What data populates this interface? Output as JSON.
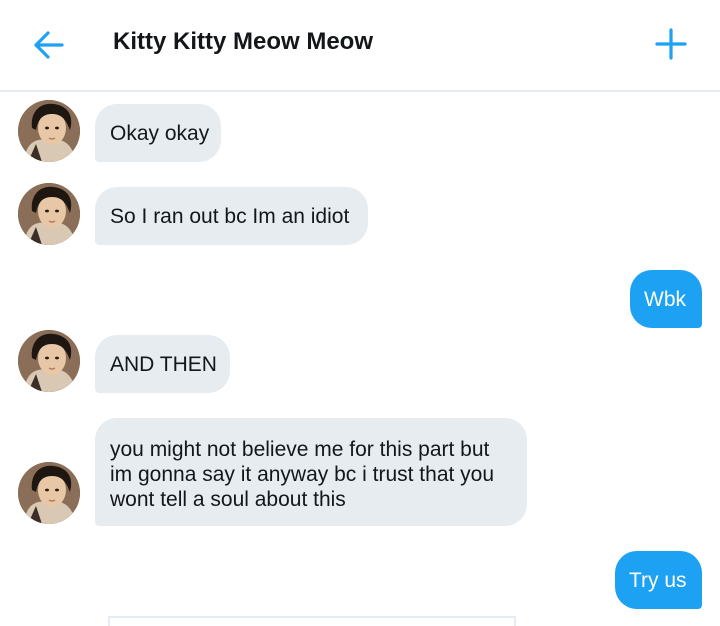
{
  "header": {
    "title": "Kitty Kitty Meow Meow",
    "back_icon": "back-arrow-icon",
    "add_icon": "plus-icon",
    "accent": "#1da1f2"
  },
  "messages": [
    {
      "direction": "incoming",
      "lines": [
        "Okay okay"
      ]
    },
    {
      "direction": "incoming",
      "lines": [
        "So I ran out bc Im an idiot"
      ]
    },
    {
      "direction": "outgoing",
      "lines": [
        "Wbk"
      ]
    },
    {
      "direction": "incoming",
      "lines": [
        "AND THEN"
      ]
    },
    {
      "direction": "incoming",
      "lines": [
        "you might not believe me for this part but",
        "im gonna say it anyway bc i trust that you",
        "wont tell a soul about this"
      ]
    },
    {
      "direction": "outgoing",
      "lines": [
        "Try us"
      ]
    }
  ],
  "colors": {
    "incoming_bubble": "#e6ecf0",
    "outgoing_bubble": "#1da1f2",
    "text": "#14171a"
  }
}
